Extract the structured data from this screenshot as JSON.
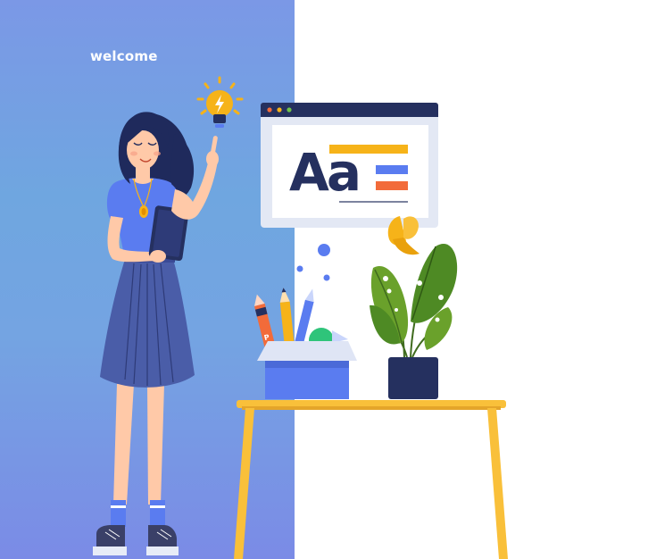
{
  "welcome_text": "welcome",
  "typography_card": {
    "sample_glyphs": "Aa"
  },
  "colors": {
    "panel_blue": "#7b98e6",
    "navy": "#25305f",
    "accent_yellow": "#f6b319",
    "accent_blue": "#5a7cf0",
    "accent_orange": "#f26b3a",
    "leaf_green": "#6aa12b",
    "table_yellow": "#f9c03a"
  },
  "icons": [
    "lightbulb-icon",
    "window-dots-icon",
    "butterfly-icon"
  ]
}
